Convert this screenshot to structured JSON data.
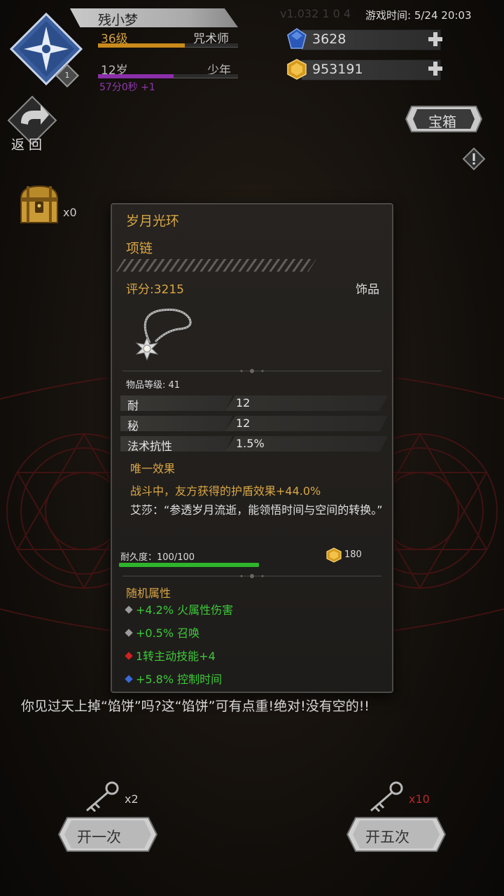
{
  "header": {
    "version_text": "v1.032 1 0 4",
    "game_time_label": "游戏时间: 5/24 20:03",
    "player": {
      "name": "残小梦",
      "level": "36级",
      "job": "咒术师",
      "exp_progress": 0.62,
      "age": "12岁",
      "stage": "少年",
      "age_progress": 0.54,
      "age_timer": "57分0秒 +1",
      "rank_badge": "1"
    },
    "currencies": {
      "gems": "3628",
      "gold": "953191"
    }
  },
  "controls": {
    "back_label": "返回",
    "chest_tab_label": "宝箱",
    "chest_count": "x0"
  },
  "item": {
    "name": "岁月光环",
    "slot": "项链",
    "score": "评分:3215",
    "category": "饰品",
    "item_level": "物品等级: 41",
    "stats": [
      {
        "label": "耐",
        "value": "12"
      },
      {
        "label": "秘",
        "value": "12"
      },
      {
        "label": "法术抗性",
        "value": "1.5%"
      }
    ],
    "unique_title": "唯一效果",
    "unique_effect": "战斗中，友方获得的护盾效果+44.0%",
    "lore": "艾莎：“参透岁月流逝，能领悟时间与空间的转换。”",
    "durability": "耐久度：100/100",
    "durability_ratio": 1.0,
    "sell_price": "180",
    "random_title": "随机属性",
    "random_attrs": [
      {
        "text": "+4.2% 火属性伤害",
        "gem_color": "#9a9a9a"
      },
      {
        "text": "+0.5% 召唤",
        "gem_color": "#9a9a9a"
      },
      {
        "text": "1转主动技能+4",
        "gem_color": "#d22020"
      },
      {
        "text": "+5.8% 控制时间",
        "gem_color": "#3a6ad8"
      }
    ]
  },
  "bottom": {
    "flavor_text": "你见过天上掉“馅饼”吗?这“馅饼”可有点重!绝对!没有空的!!",
    "open_once": {
      "label": "开一次",
      "key_count": "x2"
    },
    "open_five": {
      "label": "开五次",
      "key_count": "x10"
    }
  },
  "colors": {
    "gold_text": "#d8a645",
    "green_attr": "#3dc93a",
    "exp_bar": "#c98a1c",
    "age_bar": "#8a2fa8",
    "durability_bar": "#2fb52c"
  }
}
